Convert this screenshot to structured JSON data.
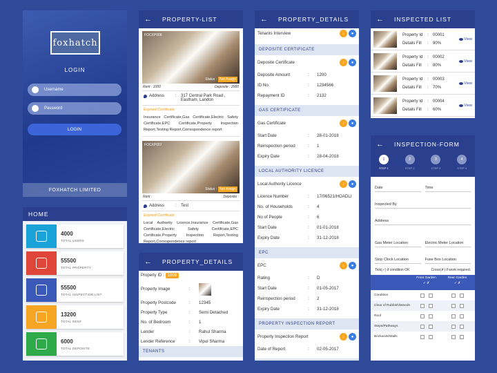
{
  "login": {
    "logo": "foxhatch",
    "title": "LOGIN",
    "username_placeholder": "Username",
    "password_placeholder": "Password",
    "button": "LOGIN",
    "footer": "FOXHATCH LIMITED"
  },
  "home": {
    "title": "HOME",
    "stats": [
      {
        "value": "4000",
        "label": "TOTAL USERS",
        "color": "#1aa3d9",
        "icon": "users-icon"
      },
      {
        "value": "55500",
        "label": "TOTAL PROPERTY",
        "color": "#e0453a",
        "icon": "building-icon"
      },
      {
        "value": "55500",
        "label": "TOTAL INSPECTION LIST",
        "color": "#3a59b8",
        "icon": "checklist-icon"
      },
      {
        "value": "13200",
        "label": "TOTAL RENT",
        "color": "#f6a623",
        "icon": "house-icon"
      },
      {
        "value": "6000",
        "label": "TOTAL DEPOSITE",
        "color": "#2faa4a",
        "icon": "wallet-icon"
      }
    ]
  },
  "plist": {
    "title": "PROPERTY-LIST",
    "cards": [
      {
        "code": "FOCXP008",
        "status_label": "Status :",
        "status": "Not Assign",
        "rent": "Rent : 1000",
        "deposite": "Deposite : 2000",
        "address_label": "Address",
        "address": "317 Central Park Road , Eastham, Landon",
        "exp_label": "Expired Certificate",
        "exp": "Insurance Certificate,Gas Certificate,Electric Safety Certificate,EPC Certificate,Property Inspection Report,Testing Report,Correspondence report"
      },
      {
        "code": "FOCXP007",
        "status_label": "Status :",
        "status": "Not Assign",
        "rent": "Rent :",
        "deposite": "Deposite :",
        "address_label": "Address",
        "address": "Test",
        "exp_label": "Expired Certificate",
        "exp": "Local Authority Licence,Insurance Certificate,Gas Certificate,Electric Safety Certificate,EPC Certificate,Property Inspection Report,Testing Report,Correspondence report"
      }
    ]
  },
  "pdetail": {
    "title": "PROPERTY_DETAILS",
    "id_label": "Property ID :",
    "id": "1006",
    "rows": [
      {
        "k": "Property Image",
        "v": ""
      },
      {
        "k": "Property Postcode",
        "v": "12345"
      },
      {
        "k": "Property Type",
        "v": "Semi Detached"
      },
      {
        "k": "No. of Bedroom",
        "v": "1"
      },
      {
        "k": "Lender",
        "v": "Rahul Sharma"
      },
      {
        "k": "Lender Reference",
        "v": "Vipul Sharma"
      }
    ],
    "tenants": "TENANTS"
  },
  "pdetail2": {
    "title": "PROPERTY_DETAILS",
    "tenants_interview": "Tenants Interview",
    "deposite": {
      "title": "DEPOSITE CERTIFICATE",
      "name": "Deposite Certificate",
      "rows": [
        {
          "k": "Deposite Amount",
          "v": "1200"
        },
        {
          "k": "ID No.",
          "v": "1234566"
        },
        {
          "k": "Repayment ID",
          "v": "2132"
        }
      ]
    },
    "gas": {
      "title": "GAS CERTIFICATE",
      "name": "Gas Certificate",
      "rows": [
        {
          "k": "Start Date",
          "v": "28-01-2018"
        },
        {
          "k": "Reinspection period",
          "v": "1"
        },
        {
          "k": "Expiry Date",
          "v": "28-04-2018"
        }
      ]
    },
    "lal": {
      "title": "LOCAL AUTHORITY LICENCE",
      "name": "Local Authority Licence",
      "rows": [
        {
          "k": "Licence Number",
          "v": "17/06521/HOADLI"
        },
        {
          "k": "No. of Households",
          "v": "4"
        },
        {
          "k": "No of People",
          "v": "6"
        },
        {
          "k": "Start Date",
          "v": "01-01-2018"
        },
        {
          "k": "Expiry Date",
          "v": "31-12-2018"
        }
      ]
    },
    "epc": {
      "title": "EPC",
      "name": "EPC",
      "rows": [
        {
          "k": "Rating",
          "v": "D"
        },
        {
          "k": "Start Date",
          "v": "01-05-2017"
        },
        {
          "k": "Reinspection period",
          "v": "2"
        },
        {
          "k": "Expiry Date",
          "v": "31-12-2018"
        }
      ]
    },
    "pir": {
      "title": "PROPERTY INSPECTION REPORT",
      "name": "Property Inspection Report",
      "rows": [
        {
          "k": "Date of Report",
          "v": "02-05-2017"
        }
      ]
    },
    "corr": "CORRESPONDENCE"
  },
  "inspected": {
    "title": "INSPECTED LIST",
    "pid_label": "Property Id",
    "fill_label": "Details Fill",
    "view": "View",
    "items": [
      {
        "id": "00001",
        "fill": "90%"
      },
      {
        "id": "00002",
        "fill": "80%"
      },
      {
        "id": "00003",
        "fill": "70%"
      },
      {
        "id": "00004",
        "fill": "60%"
      }
    ]
  },
  "iform": {
    "title": "INSPECTION-FORM",
    "steps": [
      {
        "n": "1",
        "l": "STEP 1"
      },
      {
        "n": "2",
        "l": "STEP 2"
      },
      {
        "n": "3",
        "l": "STEP 3"
      },
      {
        "n": "4",
        "l": "STEP 4"
      }
    ],
    "date": "Date",
    "time": "Time",
    "by": "Inspected By",
    "address": "Address",
    "gas_meter": "Gas Meter Location",
    "elec_meter": "Electric Meter Location",
    "stop_clock": "Stop Clock Location",
    "fuse_box": "Fuse Box Location",
    "tick": "Tick(✓) if condition OK",
    "cross": "Cross(✗) if work required.",
    "front": "Front Garden",
    "rear": "Rear Garden",
    "conds": [
      "Condition",
      "Clear of Rubbish/Weeds",
      "Roof",
      "Steps/Pathways",
      "Brickwork/Walls"
    ]
  }
}
